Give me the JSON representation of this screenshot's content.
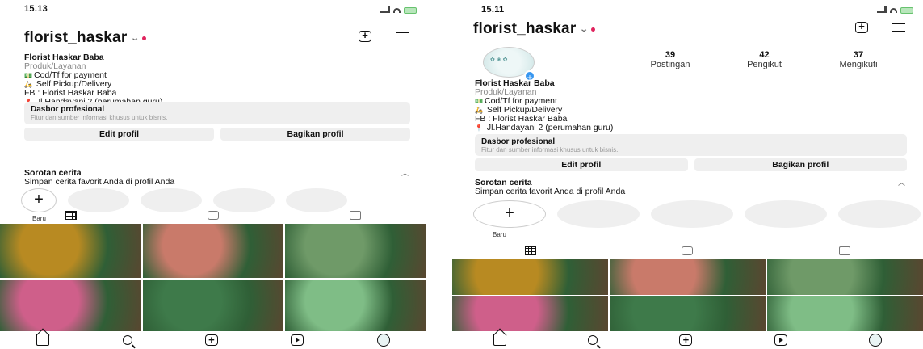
{
  "screens": [
    {
      "status_time": "15.13",
      "username": "florist_haskar",
      "bio": {
        "name": "Florist Haskar Baba",
        "category": "Produk/Layanan",
        "lines": [
          "Cod/Tf for payment",
          "Self Pickup/Delivery",
          "FB : Florist Haskar Baba",
          "Jl.Handayani 2 (perumahan guru)"
        ]
      },
      "dashboard": {
        "title": "Dasbor profesional",
        "subtitle": "Fitur dan sumber informasi khusus untuk bisnis."
      },
      "buttons": {
        "edit": "Edit profil",
        "share": "Bagikan profil"
      },
      "highlights": {
        "title": "Sorotan cerita",
        "subtitle": "Simpan cerita favorit Anda di profil Anda",
        "new_label": "Baru"
      },
      "photo_colors": [
        "#b88a22",
        "#c97a6a",
        "#6f9a68",
        "#cf5f8a",
        "#3e7a4a",
        "#7fbd86"
      ]
    },
    {
      "status_time": "15.11",
      "username": "florist_haskar",
      "stats": [
        {
          "num": "39",
          "label": "Postingan"
        },
        {
          "num": "42",
          "label": "Pengikut"
        },
        {
          "num": "37",
          "label": "Mengikuti"
        }
      ],
      "bio": {
        "name": "Florist Haskar Baba",
        "category": "Produk/Layanan",
        "lines": [
          "Cod/Tf for payment",
          "Self Pickup/Delivery",
          "FB : Florist Haskar Baba",
          "Jl.Handayani 2 (perumahan guru)"
        ]
      },
      "dashboard": {
        "title": "Dasbor profesional",
        "subtitle": "Fitur dan sumber informasi khusus untuk bisnis."
      },
      "buttons": {
        "edit": "Edit profil",
        "share": "Bagikan profil"
      },
      "highlights": {
        "title": "Sorotan cerita",
        "subtitle": "Simpan cerita favorit Anda di profil Anda",
        "new_label": "Baru"
      },
      "photo_colors": [
        "#b88a22",
        "#c97a6a",
        "#6f9a68",
        "#cf5f8a",
        "#3e7a4a",
        "#7fbd86"
      ]
    }
  ],
  "icons": {
    "status": [
      "signal-icon",
      "wifi-icon",
      "battery-icon"
    ],
    "nav": [
      "home-icon",
      "search-icon",
      "add-post-icon",
      "reels-icon",
      "profile-icon"
    ],
    "tabs": [
      "grid-icon",
      "reels-tab-icon",
      "tagged-icon"
    ]
  },
  "colors": {
    "accent": "#3897f0",
    "notification_dot": "#e0245e",
    "muted": "#efefef"
  }
}
